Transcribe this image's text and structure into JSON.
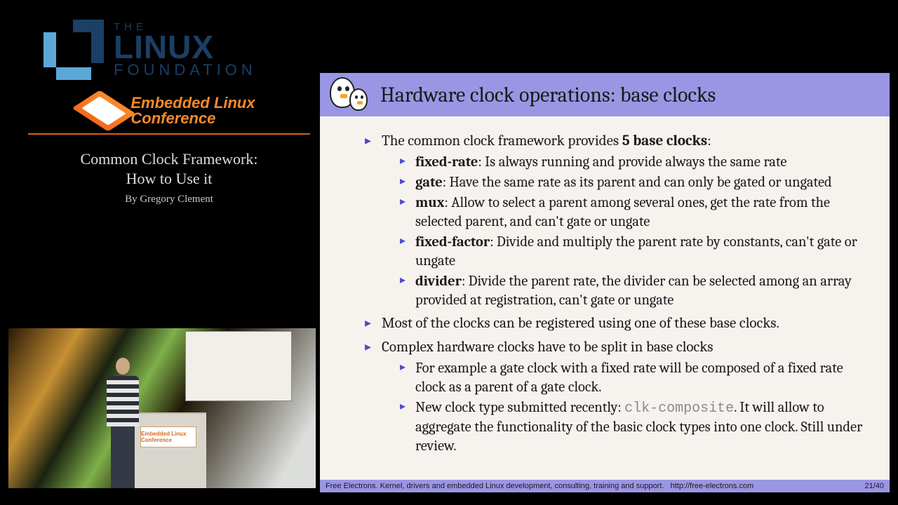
{
  "lf": {
    "the": "THE",
    "linux": "LINUX",
    "found": "FOUNDATION"
  },
  "elc": {
    "line1": "Embedded Linux",
    "line2": "Conference",
    "podium_sign": "Embedded Linux Conference"
  },
  "talk": {
    "line1": "Common Clock Framework:",
    "line2": "How to Use it",
    "byline": "By Gregory Clement"
  },
  "slide": {
    "title": "Hardware clock operations: base clocks",
    "b1_prefix": "The common clock framework provides ",
    "b1_bold": "5 base clocks",
    "b1_suffix": ":",
    "base": {
      "fixed_rate": {
        "name": "fixed-rate",
        "desc": ": Is always running and provide always the same rate"
      },
      "gate": {
        "name": "gate",
        "desc": ": Have the same rate as its parent and can only be gated or ungated"
      },
      "mux": {
        "name": "mux",
        "desc": ": Allow to select a parent among several ones, get the rate from the selected parent, and can't gate or ungate"
      },
      "fixed_factor": {
        "name": "fixed-factor",
        "desc": ": Divide and multiply the parent rate by constants, can't gate or ungate"
      },
      "divider": {
        "name": "divider",
        "desc": ": Divide the parent rate, the divider can be selected among an array provided at registration, can't gate or ungate"
      }
    },
    "b2": "Most of the clocks can be registered using one of these base clocks.",
    "b3": "Complex hardware clocks have to be split in base clocks",
    "sub2": {
      "s1": "For example a gate clock with a fixed rate will be composed of a fixed rate clock as a parent of a gate clock.",
      "s2_prefix": "New clock type submitted recently: ",
      "s2_code": "clk-composite",
      "s2_suffix": ". It will allow to aggregate the functionality of the basic clock types into one clock. Still under review."
    },
    "footer_left": "Free Electrons. Kernel, drivers and embedded Linux development, consulting, training and support.",
    "footer_url": "http://free-electrons.com",
    "footer_page": "21/40"
  }
}
